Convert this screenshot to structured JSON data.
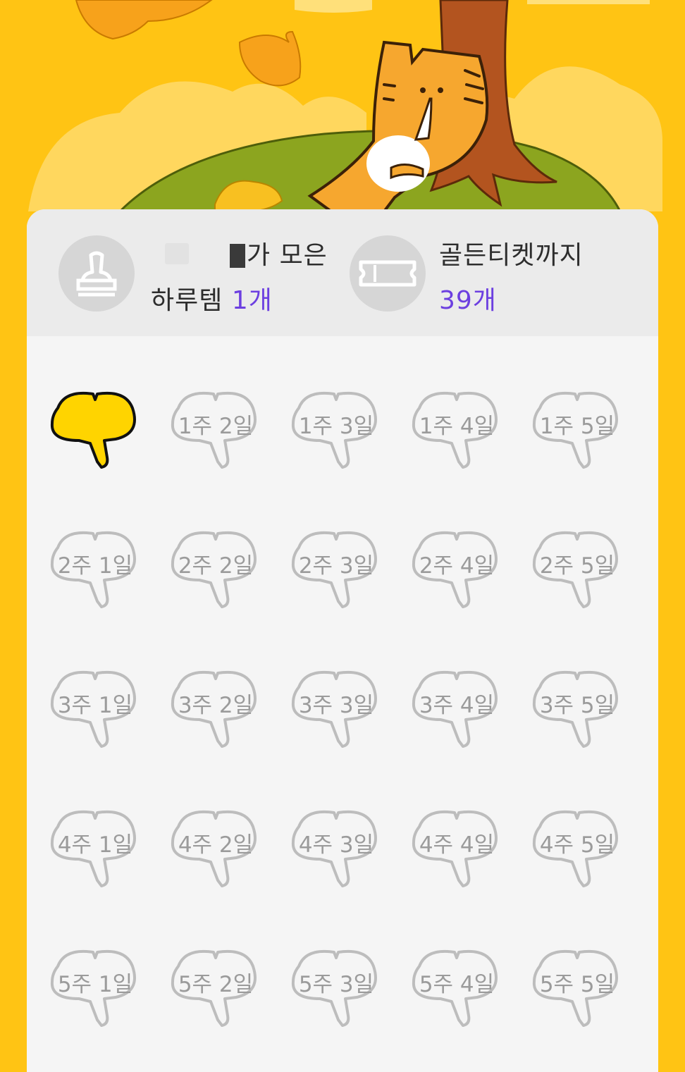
{
  "header": {
    "collector_suffix": "가 모은",
    "item_label": "하루템",
    "item_count": "1개",
    "golden_label": "골든티켓까지",
    "golden_count": "39개"
  },
  "icons": {
    "stamp": "stamp-icon",
    "ticket": "ticket-icon",
    "leaf": "ginkgo-leaf-icon"
  },
  "colors": {
    "background": "#FFC414",
    "accent": "#6C3FE0",
    "leaf_collected": "#FFD400",
    "leaf_empty": "#BDBDBD"
  },
  "calendar": {
    "collected_count": 1,
    "cells": [
      {
        "label": "",
        "collected": true
      },
      {
        "label": "1주 2일",
        "collected": false
      },
      {
        "label": "1주 3일",
        "collected": false
      },
      {
        "label": "1주 4일",
        "collected": false
      },
      {
        "label": "1주 5일",
        "collected": false
      },
      {
        "label": "2주 1일",
        "collected": false
      },
      {
        "label": "2주 2일",
        "collected": false
      },
      {
        "label": "2주 3일",
        "collected": false
      },
      {
        "label": "2주 4일",
        "collected": false
      },
      {
        "label": "2주 5일",
        "collected": false
      },
      {
        "label": "3주 1일",
        "collected": false
      },
      {
        "label": "3주 2일",
        "collected": false
      },
      {
        "label": "3주 3일",
        "collected": false
      },
      {
        "label": "3주 4일",
        "collected": false
      },
      {
        "label": "3주 5일",
        "collected": false
      },
      {
        "label": "4주 1일",
        "collected": false
      },
      {
        "label": "4주 2일",
        "collected": false
      },
      {
        "label": "4주 3일",
        "collected": false
      },
      {
        "label": "4주 4일",
        "collected": false
      },
      {
        "label": "4주 5일",
        "collected": false
      },
      {
        "label": "5주 1일",
        "collected": false
      },
      {
        "label": "5주 2일",
        "collected": false
      },
      {
        "label": "5주 3일",
        "collected": false
      },
      {
        "label": "5주 4일",
        "collected": false
      },
      {
        "label": "5주 5일",
        "collected": false
      }
    ]
  }
}
